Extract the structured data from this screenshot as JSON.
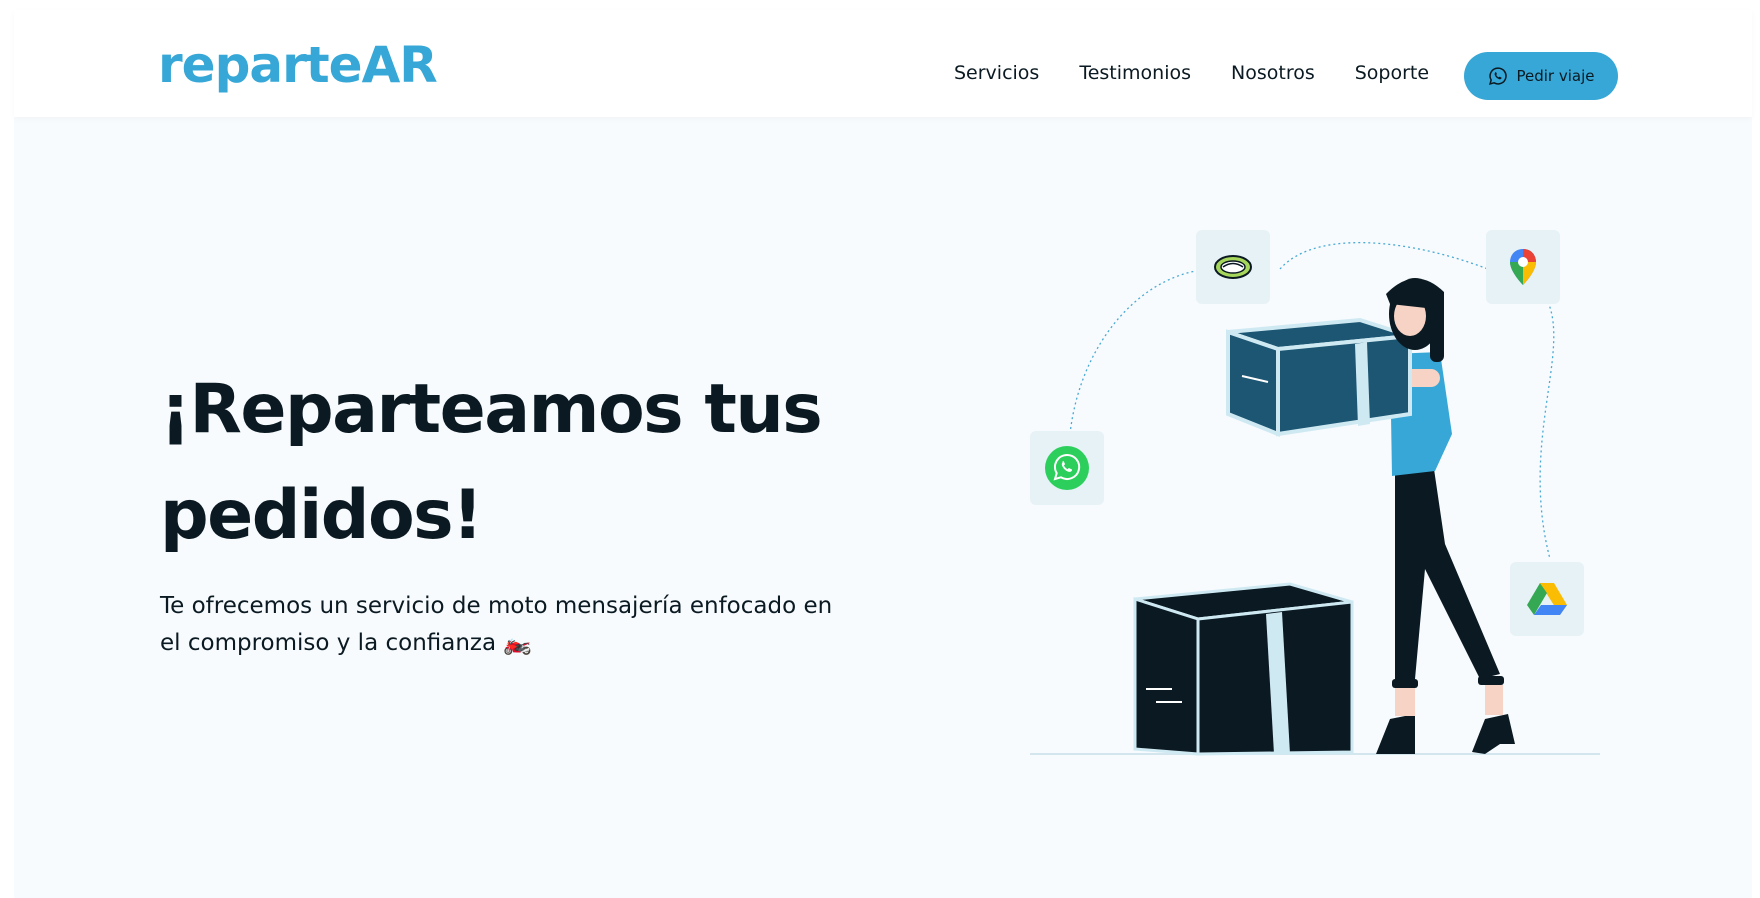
{
  "brand": {
    "logo_text": "reparteAR",
    "logo_prefix": "partea",
    "accent_color": "#36a7d6"
  },
  "nav": {
    "links": [
      {
        "label": "Servicios"
      },
      {
        "label": "Testimonios"
      },
      {
        "label": "Nosotros"
      },
      {
        "label": "Soporte"
      }
    ],
    "cta_label": "Pedir viaje",
    "cta_icon": "whatsapp-icon"
  },
  "hero": {
    "title": "¡Reparteamos tus pedidos!",
    "subtitle": "Te ofrecemos un servicio de moto mensajería enfocado en el compromiso y la confianza 🏍️"
  },
  "illustration": {
    "app_icons": [
      "mercadopago-handshake-icon",
      "google-maps-icon",
      "whatsapp-icon",
      "google-drive-icon"
    ]
  }
}
